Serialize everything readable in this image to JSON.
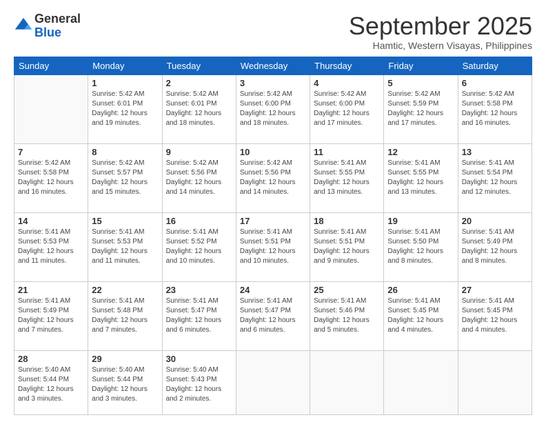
{
  "logo": {
    "general": "General",
    "blue": "Blue"
  },
  "title": "September 2025",
  "subtitle": "Hamtic, Western Visayas, Philippines",
  "days_of_week": [
    "Sunday",
    "Monday",
    "Tuesday",
    "Wednesday",
    "Thursday",
    "Friday",
    "Saturday"
  ],
  "weeks": [
    [
      {
        "day": "",
        "info": ""
      },
      {
        "day": "1",
        "info": "Sunrise: 5:42 AM\nSunset: 6:01 PM\nDaylight: 12 hours\nand 19 minutes."
      },
      {
        "day": "2",
        "info": "Sunrise: 5:42 AM\nSunset: 6:01 PM\nDaylight: 12 hours\nand 18 minutes."
      },
      {
        "day": "3",
        "info": "Sunrise: 5:42 AM\nSunset: 6:00 PM\nDaylight: 12 hours\nand 18 minutes."
      },
      {
        "day": "4",
        "info": "Sunrise: 5:42 AM\nSunset: 6:00 PM\nDaylight: 12 hours\nand 17 minutes."
      },
      {
        "day": "5",
        "info": "Sunrise: 5:42 AM\nSunset: 5:59 PM\nDaylight: 12 hours\nand 17 minutes."
      },
      {
        "day": "6",
        "info": "Sunrise: 5:42 AM\nSunset: 5:58 PM\nDaylight: 12 hours\nand 16 minutes."
      }
    ],
    [
      {
        "day": "7",
        "info": "Sunrise: 5:42 AM\nSunset: 5:58 PM\nDaylight: 12 hours\nand 16 minutes."
      },
      {
        "day": "8",
        "info": "Sunrise: 5:42 AM\nSunset: 5:57 PM\nDaylight: 12 hours\nand 15 minutes."
      },
      {
        "day": "9",
        "info": "Sunrise: 5:42 AM\nSunset: 5:56 PM\nDaylight: 12 hours\nand 14 minutes."
      },
      {
        "day": "10",
        "info": "Sunrise: 5:42 AM\nSunset: 5:56 PM\nDaylight: 12 hours\nand 14 minutes."
      },
      {
        "day": "11",
        "info": "Sunrise: 5:41 AM\nSunset: 5:55 PM\nDaylight: 12 hours\nand 13 minutes."
      },
      {
        "day": "12",
        "info": "Sunrise: 5:41 AM\nSunset: 5:55 PM\nDaylight: 12 hours\nand 13 minutes."
      },
      {
        "day": "13",
        "info": "Sunrise: 5:41 AM\nSunset: 5:54 PM\nDaylight: 12 hours\nand 12 minutes."
      }
    ],
    [
      {
        "day": "14",
        "info": "Sunrise: 5:41 AM\nSunset: 5:53 PM\nDaylight: 12 hours\nand 11 minutes."
      },
      {
        "day": "15",
        "info": "Sunrise: 5:41 AM\nSunset: 5:53 PM\nDaylight: 12 hours\nand 11 minutes."
      },
      {
        "day": "16",
        "info": "Sunrise: 5:41 AM\nSunset: 5:52 PM\nDaylight: 12 hours\nand 10 minutes."
      },
      {
        "day": "17",
        "info": "Sunrise: 5:41 AM\nSunset: 5:51 PM\nDaylight: 12 hours\nand 10 minutes."
      },
      {
        "day": "18",
        "info": "Sunrise: 5:41 AM\nSunset: 5:51 PM\nDaylight: 12 hours\nand 9 minutes."
      },
      {
        "day": "19",
        "info": "Sunrise: 5:41 AM\nSunset: 5:50 PM\nDaylight: 12 hours\nand 8 minutes."
      },
      {
        "day": "20",
        "info": "Sunrise: 5:41 AM\nSunset: 5:49 PM\nDaylight: 12 hours\nand 8 minutes."
      }
    ],
    [
      {
        "day": "21",
        "info": "Sunrise: 5:41 AM\nSunset: 5:49 PM\nDaylight: 12 hours\nand 7 minutes."
      },
      {
        "day": "22",
        "info": "Sunrise: 5:41 AM\nSunset: 5:48 PM\nDaylight: 12 hours\nand 7 minutes."
      },
      {
        "day": "23",
        "info": "Sunrise: 5:41 AM\nSunset: 5:47 PM\nDaylight: 12 hours\nand 6 minutes."
      },
      {
        "day": "24",
        "info": "Sunrise: 5:41 AM\nSunset: 5:47 PM\nDaylight: 12 hours\nand 6 minutes."
      },
      {
        "day": "25",
        "info": "Sunrise: 5:41 AM\nSunset: 5:46 PM\nDaylight: 12 hours\nand 5 minutes."
      },
      {
        "day": "26",
        "info": "Sunrise: 5:41 AM\nSunset: 5:45 PM\nDaylight: 12 hours\nand 4 minutes."
      },
      {
        "day": "27",
        "info": "Sunrise: 5:41 AM\nSunset: 5:45 PM\nDaylight: 12 hours\nand 4 minutes."
      }
    ],
    [
      {
        "day": "28",
        "info": "Sunrise: 5:40 AM\nSunset: 5:44 PM\nDaylight: 12 hours\nand 3 minutes."
      },
      {
        "day": "29",
        "info": "Sunrise: 5:40 AM\nSunset: 5:44 PM\nDaylight: 12 hours\nand 3 minutes."
      },
      {
        "day": "30",
        "info": "Sunrise: 5:40 AM\nSunset: 5:43 PM\nDaylight: 12 hours\nand 2 minutes."
      },
      {
        "day": "",
        "info": ""
      },
      {
        "day": "",
        "info": ""
      },
      {
        "day": "",
        "info": ""
      },
      {
        "day": "",
        "info": ""
      }
    ]
  ]
}
